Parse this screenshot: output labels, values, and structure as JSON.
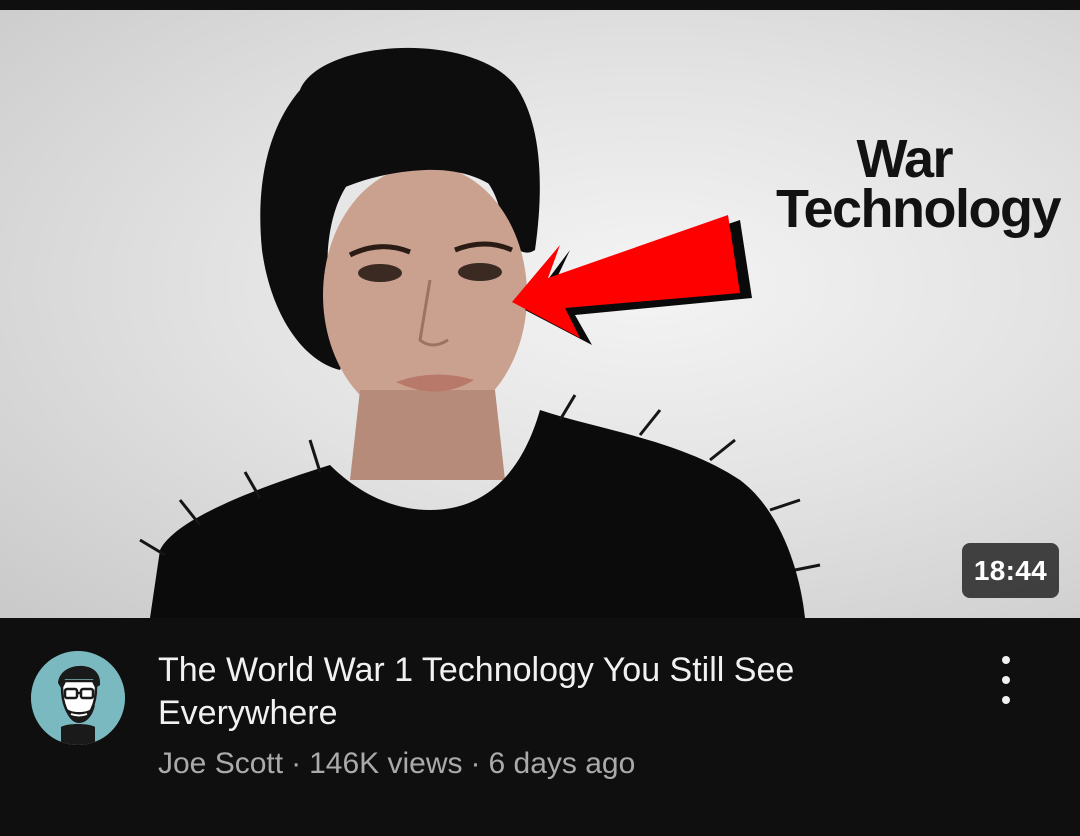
{
  "video": {
    "thumbnail_text_line1": "War",
    "thumbnail_text_line2": "Technology",
    "duration": "18:44",
    "title": "The World War 1 Technology You Still See Everywhere",
    "channel": "Joe Scott",
    "separator": "·",
    "views": "146K views",
    "age": "6 days ago"
  },
  "colors": {
    "background": "#0f0f0f",
    "arrow": "#ff0000",
    "avatar_bg": "#7ab9bf",
    "title_text": "#f1f1f1",
    "meta_text": "#aaaaaa"
  },
  "icons": {
    "menu": "more-vert-icon",
    "avatar": "channel-avatar-caricature"
  }
}
